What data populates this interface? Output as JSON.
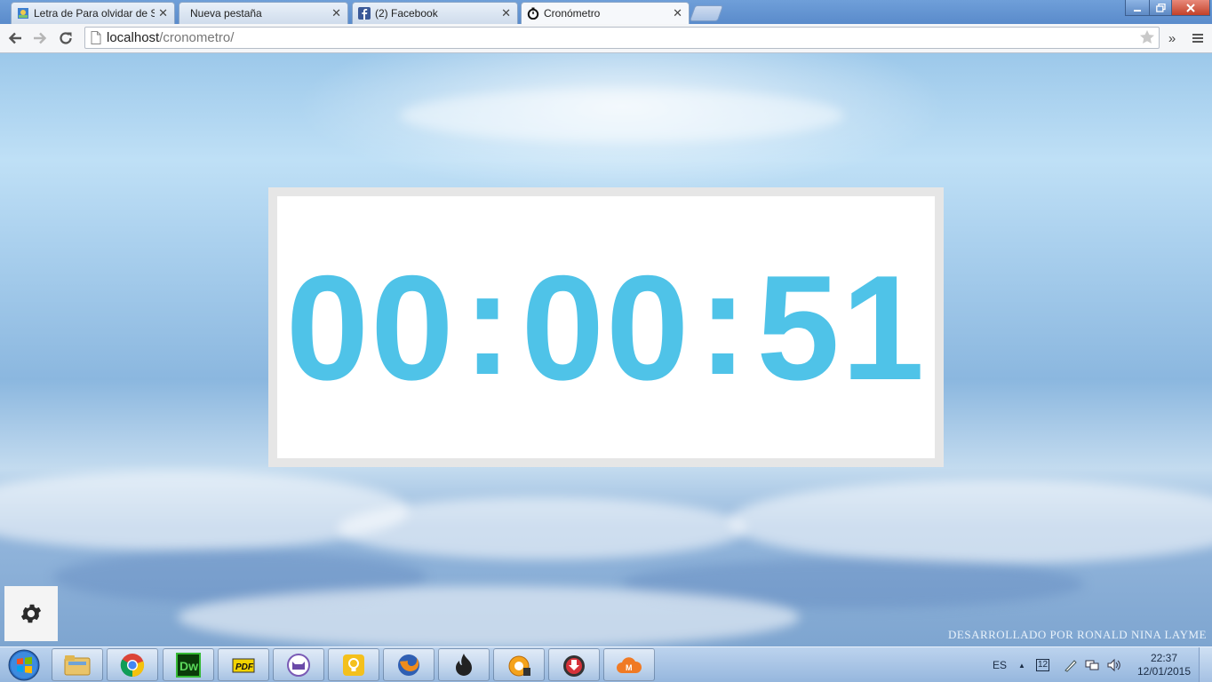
{
  "browser": {
    "tabs": [
      {
        "label": "Letra de Para olvidar de Se",
        "icon": "lyrics-site-icon",
        "active": false
      },
      {
        "label": "Nueva pestaña",
        "icon": "",
        "active": false
      },
      {
        "label": "(2) Facebook",
        "icon": "facebook-icon",
        "active": false
      },
      {
        "label": "Cronómetro",
        "icon": "stopwatch-icon",
        "active": true
      }
    ],
    "address": {
      "host": "localhost",
      "path": "/cronometro/"
    },
    "close_glyph": "✕",
    "overflow_glyph": "»"
  },
  "timer": {
    "hours": "00",
    "minutes": "00",
    "seconds": "51",
    "separator": ":",
    "color": "#4fc3e8"
  },
  "footer": {
    "credit": "DESARROLLADO POR RONALD NINA LAYME"
  },
  "taskbar": {
    "apps": [
      "folder-icon",
      "chrome-icon",
      "dreamweaver-icon",
      "pdf-icon",
      "purple-cat-icon",
      "lightbulb-icon",
      "firefox-icon",
      "fire-icon",
      "media-player-icon",
      "download-icon",
      "cloud-m-icon"
    ],
    "tray": {
      "lang": "ES",
      "up_arrow": "▲",
      "badge": "12"
    },
    "clock": {
      "time": "22:37",
      "date": "12/01/2015"
    }
  }
}
